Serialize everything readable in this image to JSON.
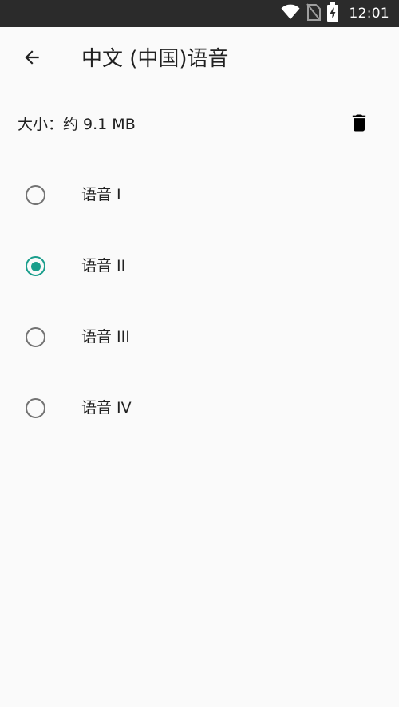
{
  "status_bar": {
    "time": "12:01",
    "icons": [
      "wifi-icon",
      "no-sim-icon",
      "battery-charging-icon"
    ]
  },
  "toolbar": {
    "back_icon": "arrow-back-icon",
    "title": "中文 (中国)语音"
  },
  "size_info": {
    "text": "大小：约 9.1 MB",
    "delete_icon": "trash-icon"
  },
  "voices": [
    {
      "label": "语音 I",
      "selected": false
    },
    {
      "label": "语音 II",
      "selected": true
    },
    {
      "label": "语音 III",
      "selected": false
    },
    {
      "label": "语音 IV",
      "selected": false
    }
  ],
  "colors": {
    "status_bar_bg": "#2b2b2b",
    "background": "#fafafa",
    "accent": "#1a9e8c",
    "radio_unchecked": "#737373",
    "text": "#212121"
  }
}
